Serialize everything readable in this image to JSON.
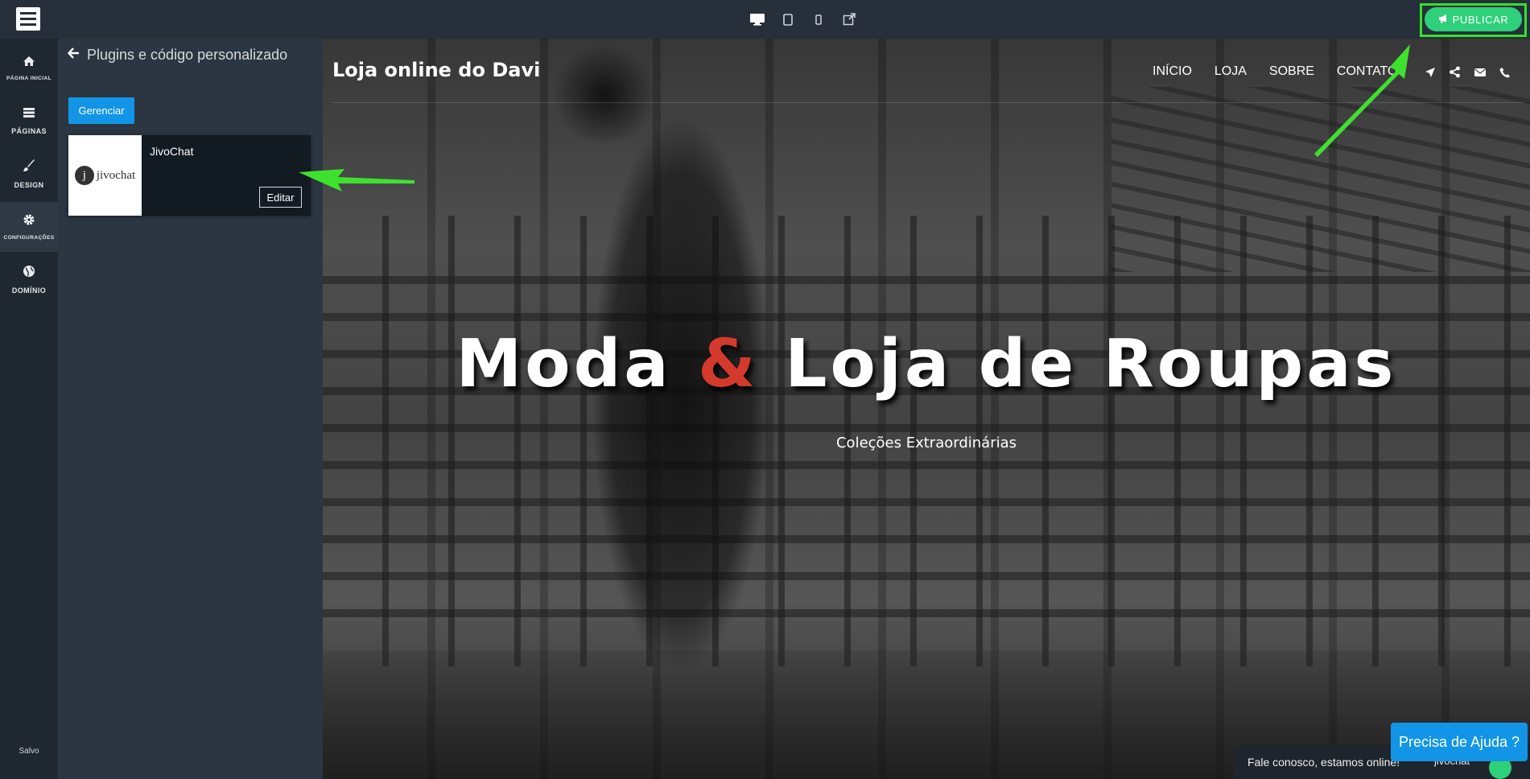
{
  "topbar": {
    "devices": [
      "desktop-icon",
      "tablet-icon",
      "mobile-icon",
      "external-link-icon"
    ],
    "publish_label": "PUBLICAR"
  },
  "leftnav": {
    "items": [
      {
        "label": "PÁGINA INICIAL",
        "icon": "home-icon"
      },
      {
        "label": "PÁGINAS",
        "icon": "pages-icon"
      },
      {
        "label": "DESIGN",
        "icon": "brush-icon"
      },
      {
        "label": "CONFIGURAÇÕES",
        "icon": "gear-icon",
        "active": true
      },
      {
        "label": "DOMÍNIO",
        "icon": "globe-icon"
      }
    ],
    "saved_label": "Salvo"
  },
  "panel": {
    "title": "Plugins e código personalizado",
    "manage_label": "Gerenciar",
    "plugin": {
      "name": "JivoChat",
      "logo_letter": "j",
      "logo_text": "jivochat",
      "edit_label": "Editar"
    }
  },
  "site": {
    "title": "Loja online do Davi",
    "nav": [
      "INÍCIO",
      "LOJA",
      "SOBRE",
      "CONTATO"
    ],
    "icons": [
      "location-arrow-icon",
      "share-icon",
      "envelope-icon",
      "phone-icon"
    ],
    "hero_title_a": "Moda ",
    "hero_amp": "&",
    "hero_title_b": " Loja de Roupas",
    "hero_subtitle": "Coleções Extraordinárias"
  },
  "chat": {
    "text": "Fale conosco, estamos online!",
    "brand": "jivochat",
    "help_label": "Precisa de Ajuda ?"
  },
  "colors": {
    "accent_green": "#2fd07a",
    "button_blue": "#1295e6",
    "annotation_green": "#35e02b",
    "hero_amp": "#d33a2c"
  }
}
